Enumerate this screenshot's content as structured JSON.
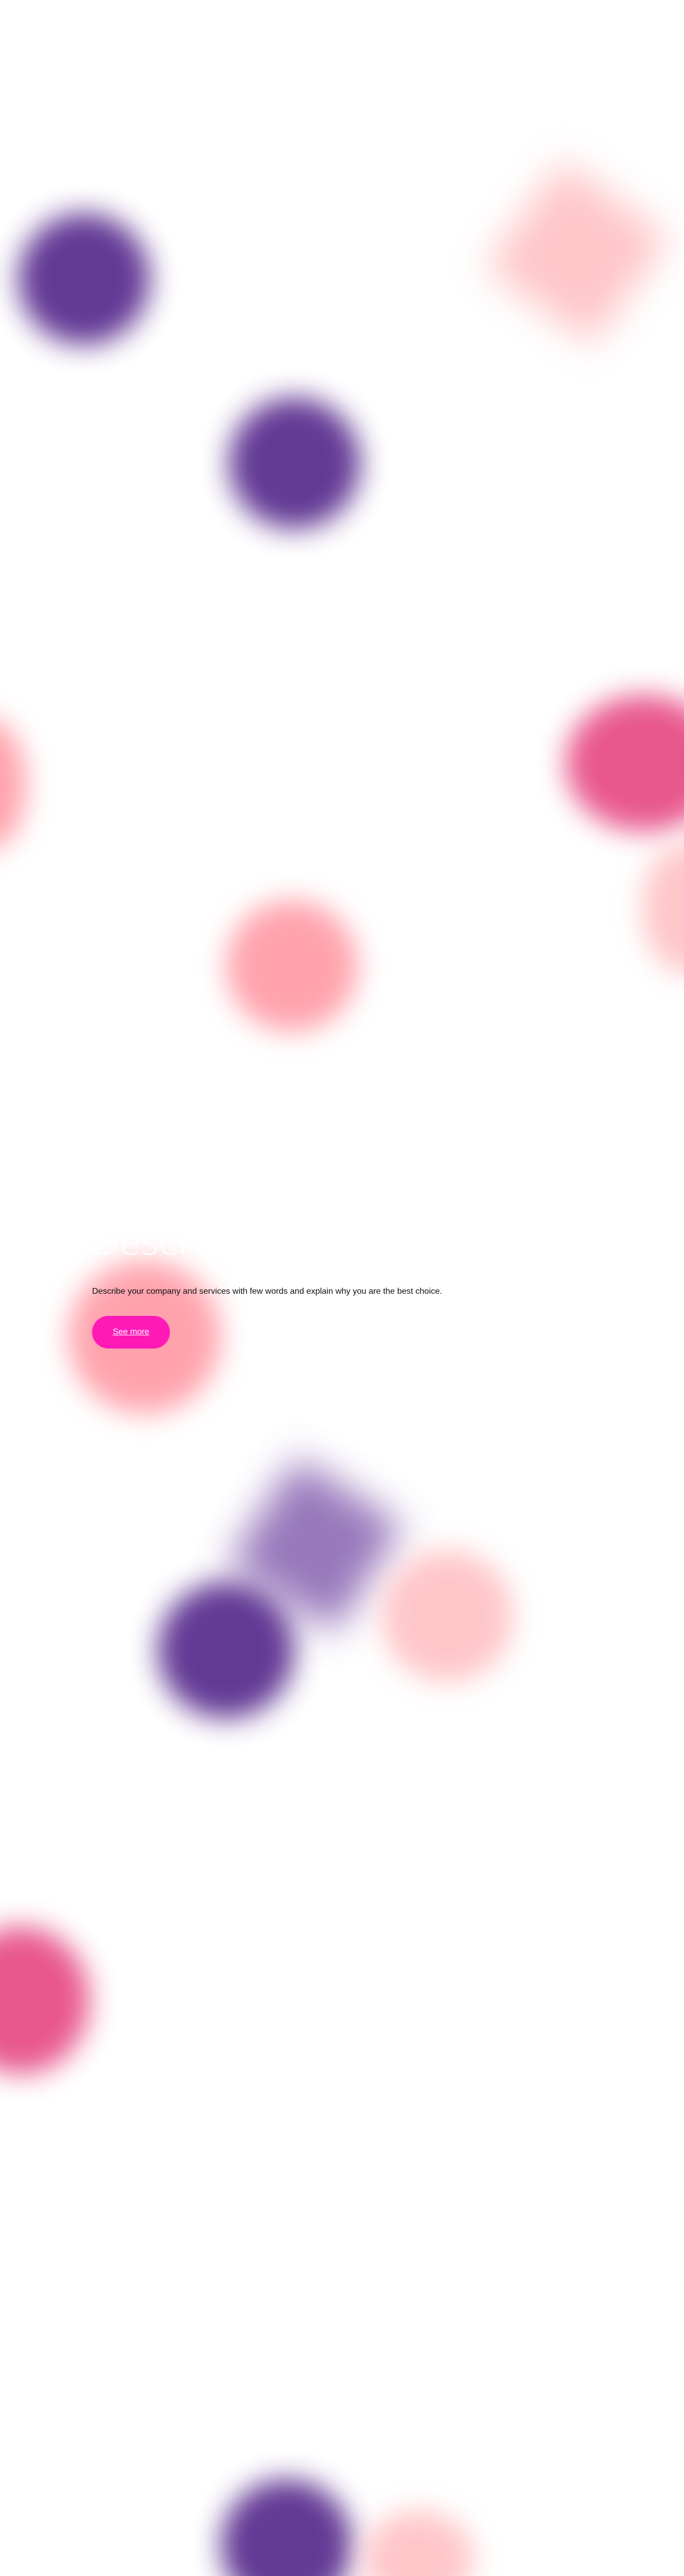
{
  "hero": {
    "title": "Describe y",
    "subtitle": "Describe your company and services with few words and explain why you are the best choice.",
    "button_label": "See more"
  },
  "theme": {
    "accent": "#ff1ab8",
    "purple": "#5b2f8f",
    "pink": "#ff9ea8",
    "rose": "#e74f86",
    "peach": "#ffc3c6",
    "lilac": "#8d6ab4",
    "background": "#ffffff",
    "text": "#111111"
  }
}
